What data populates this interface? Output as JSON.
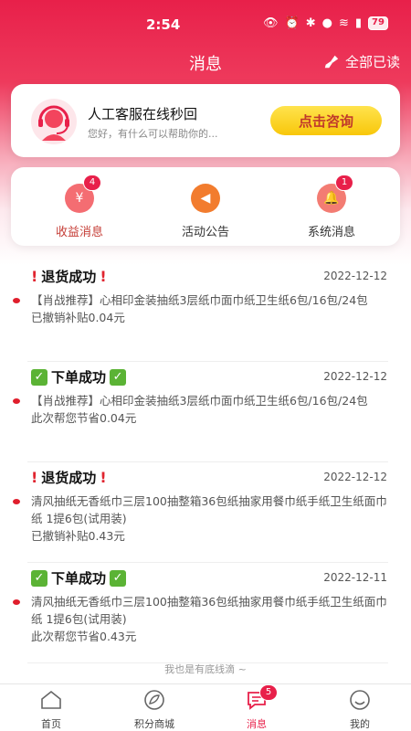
{
  "status_bar": {
    "time": "2:54",
    "battery": "79"
  },
  "header": {
    "title": "消息",
    "read_all": "全部已读"
  },
  "service": {
    "title": "人工客服在线秒回",
    "subtitle": "您好，有什么可以帮助你的...",
    "button": "点击咨询"
  },
  "categories": [
    {
      "label": "收益消息",
      "badge": "4",
      "icon": "money-bag-icon",
      "color": "#f46d72"
    },
    {
      "label": "活动公告",
      "badge": "",
      "icon": "megaphone-icon",
      "color": "#f27c2e"
    },
    {
      "label": "系统消息",
      "badge": "1",
      "icon": "bell-icon",
      "color": "#f37c73"
    }
  ],
  "messages": [
    {
      "title": "退货成功",
      "mark": "exclamation",
      "date": "2022-12-12",
      "body": "【肖战推荐】心相印金装抽纸3层纸巾面巾纸卫生纸6包/16包/24包",
      "note": "已撤销补贴0.04元"
    },
    {
      "title": "下单成功",
      "mark": "check",
      "date": "2022-12-12",
      "body": "【肖战推荐】心相印金装抽纸3层纸巾面巾纸卫生纸6包/16包/24包",
      "note": "此次帮您节省0.04元"
    },
    {
      "title": "退货成功",
      "mark": "exclamation",
      "date": "2022-12-12",
      "body": "清风抽纸无香纸巾三层100抽整箱36包纸抽家用餐巾纸手纸卫生纸面巾纸 1提6包(试用装)",
      "note": "已撤销补贴0.43元"
    },
    {
      "title": "下单成功",
      "mark": "check",
      "date": "2022-12-11",
      "body": "清风抽纸无香纸巾三层100抽整箱36包纸抽家用餐巾纸手纸卫生纸面巾纸 1提6包(试用装)",
      "note": "此次帮您节省0.43元"
    }
  ],
  "end_note": "我也是有底线滴 ~",
  "tabs": [
    {
      "label": "首页",
      "icon": "home-icon",
      "badge": ""
    },
    {
      "label": "积分商城",
      "icon": "leaf-icon",
      "badge": ""
    },
    {
      "label": "消息",
      "icon": "chat-icon",
      "badge": "5"
    },
    {
      "label": "我的",
      "icon": "smile-icon",
      "badge": ""
    }
  ],
  "colors": {
    "brand": "#e8204a",
    "button": "#f8c70a"
  }
}
